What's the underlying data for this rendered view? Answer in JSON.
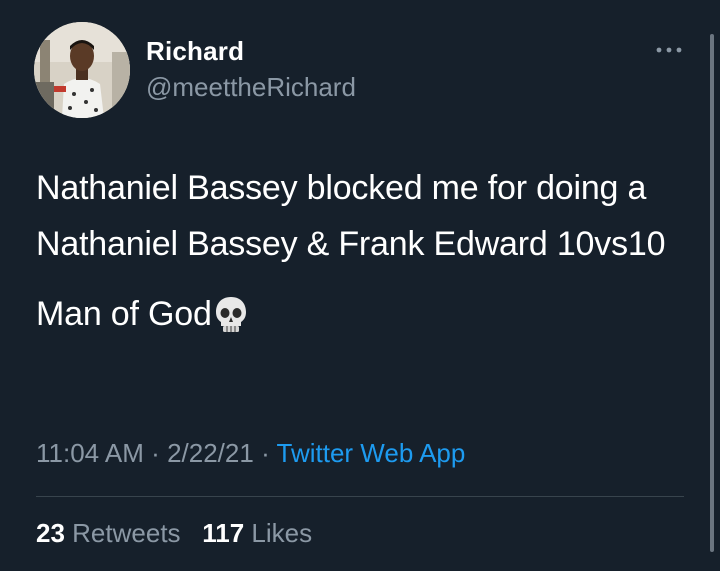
{
  "user": {
    "display_name": "Richard",
    "handle": "@meettheRichard"
  },
  "tweet": {
    "paragraph1": "Nathaniel Bassey blocked me for doing a Nathaniel Bassey & Frank Edward 10vs10",
    "paragraph2": "Man of God",
    "emoji": "skull-emoji"
  },
  "meta": {
    "time": "11:04 AM",
    "separator1": "·",
    "date": "2/22/21",
    "separator2": "·",
    "source": "Twitter Web App"
  },
  "stats": {
    "retweets_count": "23",
    "retweets_label": "Retweets",
    "likes_count": "117",
    "likes_label": "Likes"
  },
  "colors": {
    "background": "#16202b",
    "text_primary": "#ffffff",
    "text_secondary": "#8b98a5",
    "link": "#1d9bf0",
    "divider": "#38444d"
  },
  "icons": {
    "more": "more-horizontal-icon",
    "avatar": "profile-photo"
  }
}
